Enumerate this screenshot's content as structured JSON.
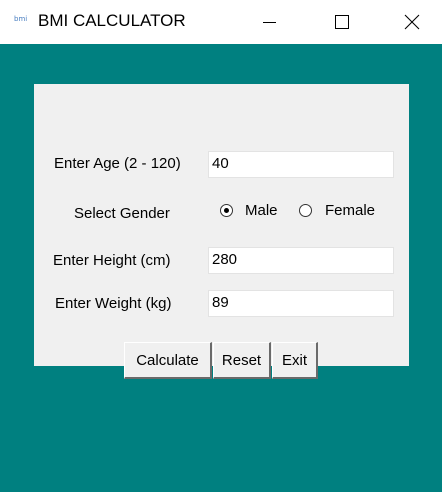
{
  "window": {
    "app_icon_text": "bmi",
    "title": "BMI CALCULATOR",
    "minimize_glyph": "minimize",
    "maximize_glyph": "maximize",
    "close_glyph": "✕"
  },
  "colors": {
    "background": "#008080",
    "panel": "#f0f0f0"
  },
  "form": {
    "age_label": "Enter Age (2 - 120)",
    "age_value": "40",
    "gender_label": "Select Gender",
    "gender_options": [
      {
        "label": "Male",
        "selected": true
      },
      {
        "label": "Female",
        "selected": false
      }
    ],
    "height_label": "Enter Height (cm)",
    "height_value": "280",
    "weight_label": "Enter Weight (kg)",
    "weight_value": "89"
  },
  "buttons": {
    "calculate": "Calculate",
    "reset": "Reset",
    "exit": "Exit"
  }
}
